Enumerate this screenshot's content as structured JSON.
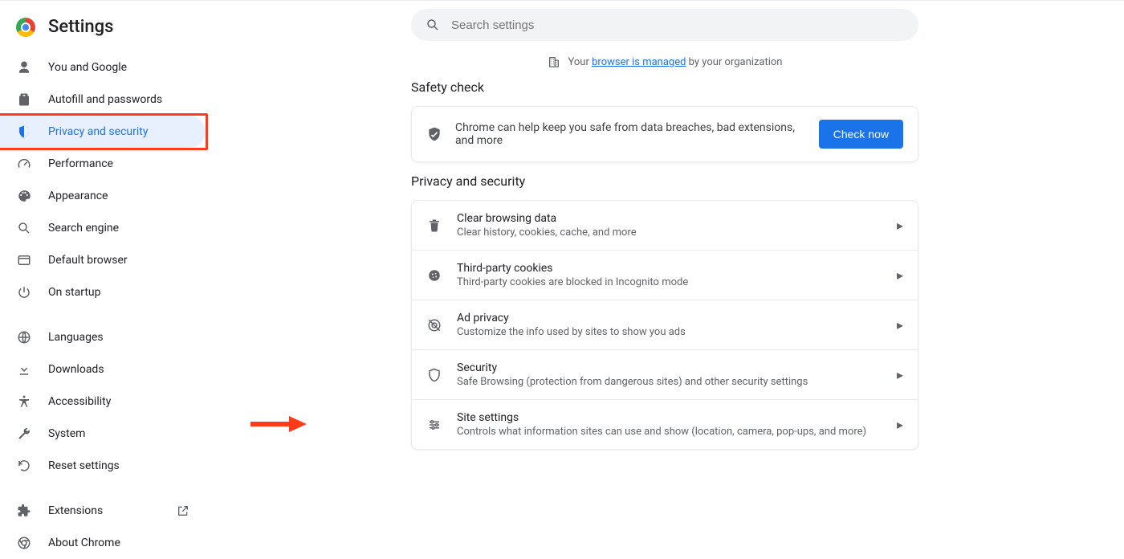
{
  "header": {
    "title": "Settings"
  },
  "search": {
    "placeholder": "Search settings"
  },
  "managed": {
    "prefix": "Your ",
    "link": "browser is managed",
    "suffix": " by your organization"
  },
  "sidebar": {
    "primary": [
      {
        "icon": "person",
        "label": "You and Google"
      },
      {
        "icon": "clipboard",
        "label": "Autofill and passwords"
      },
      {
        "icon": "shield",
        "label": "Privacy and security",
        "selected": true
      },
      {
        "icon": "speed",
        "label": "Performance"
      },
      {
        "icon": "palette",
        "label": "Appearance"
      },
      {
        "icon": "search",
        "label": "Search engine"
      },
      {
        "icon": "window",
        "label": "Default browser"
      },
      {
        "icon": "power",
        "label": "On startup"
      }
    ],
    "secondary": [
      {
        "icon": "globe",
        "label": "Languages"
      },
      {
        "icon": "download",
        "label": "Downloads"
      },
      {
        "icon": "accessibility",
        "label": "Accessibility"
      },
      {
        "icon": "wrench",
        "label": "System"
      },
      {
        "icon": "restore",
        "label": "Reset settings"
      }
    ],
    "footer": [
      {
        "icon": "puzzle",
        "label": "Extensions",
        "external": true
      },
      {
        "icon": "chrome",
        "label": "About Chrome"
      }
    ]
  },
  "safety": {
    "title": "Safety check",
    "text": "Chrome can help keep you safe from data breaches, bad extensions, and more",
    "button": "Check now"
  },
  "privacy": {
    "title": "Privacy and security",
    "rows": [
      {
        "icon": "trash",
        "title": "Clear browsing data",
        "sub": "Clear history, cookies, cache, and more"
      },
      {
        "icon": "cookie",
        "title": "Third-party cookies",
        "sub": "Third-party cookies are blocked in Incognito mode"
      },
      {
        "icon": "adprivacy",
        "title": "Ad privacy",
        "sub": "Customize the info used by sites to show you ads"
      },
      {
        "icon": "shield-outline",
        "title": "Security",
        "sub": "Safe Browsing (protection from dangerous sites) and other security settings"
      },
      {
        "icon": "tune",
        "title": "Site settings",
        "sub": "Controls what information sites can use and show (location, camera, pop-ups, and more)"
      }
    ]
  }
}
